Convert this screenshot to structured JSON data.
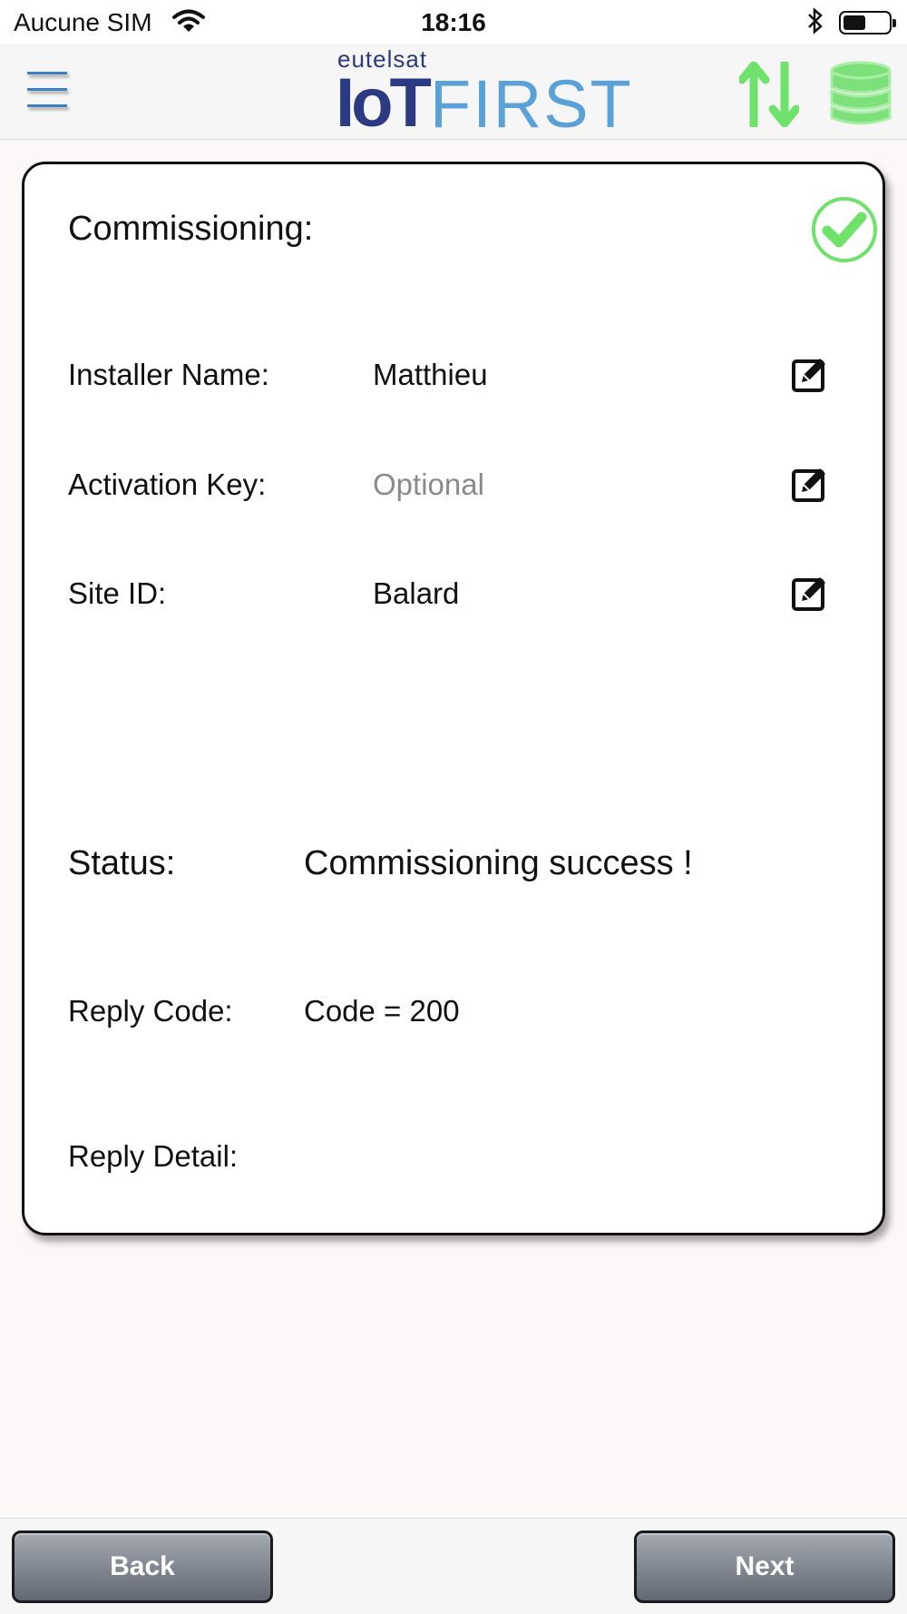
{
  "status_bar": {
    "carrier": "Aucune SIM",
    "time": "18:16"
  },
  "header": {
    "logo_brand": "eutelsat",
    "logo_iot": "IoT",
    "logo_first": "FIRST",
    "icons": [
      "menu-icon",
      "sync-arrows-icon",
      "database-icon"
    ]
  },
  "card": {
    "title": "Commissioning:",
    "status_icon": "check-circle-icon",
    "fields": [
      {
        "label": "Installer Name:",
        "value": "Matthieu",
        "placeholder": ""
      },
      {
        "label": "Activation Key:",
        "value": "",
        "placeholder": "Optional"
      },
      {
        "label": "Site ID:",
        "value": "Balard",
        "placeholder": ""
      }
    ],
    "status_label": "Status:",
    "status_value": "Commissioning success !",
    "reply_code_label": "Reply Code:",
    "reply_code_value": "Code = 200",
    "reply_detail_label": "Reply Detail:",
    "reply_detail_value": ""
  },
  "footer": {
    "back_label": "Back",
    "next_label": "Next"
  },
  "colors": {
    "accent_green": "#6ee26a",
    "logo_dark_blue": "#2b3a82",
    "logo_light_blue": "#5aa1d8",
    "menu_blue": "#3e7fc4"
  }
}
